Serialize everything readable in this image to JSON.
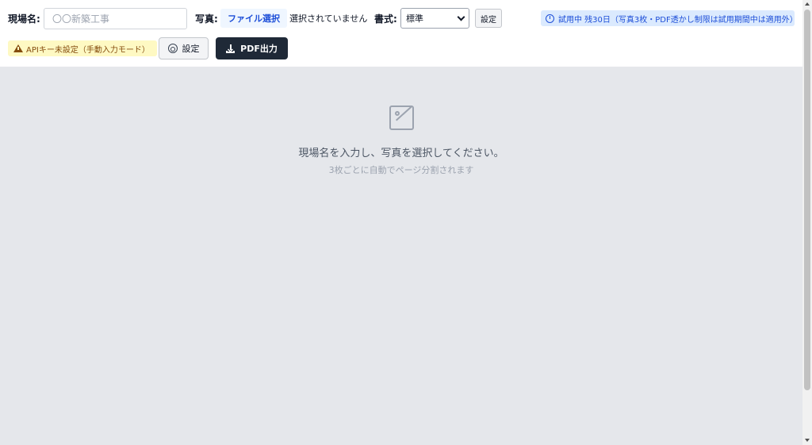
{
  "toolbar": {
    "site_label": "現場名:",
    "site_placeholder": "〇〇新築工事",
    "site_value": "",
    "photo_label": "写真:",
    "file_button": "ファイル選択",
    "file_status": "選択されていません",
    "format_label": "書式:",
    "format_selected": "標準",
    "settings_small": "設定",
    "trial_badge": "試用中 残30日（写真3枚・PDF透かし制限は試用期間中は適用外）",
    "api_badge": "APIキー未設定（手動入力モード）",
    "settings_button": "設定",
    "pdf_button": "PDF出力"
  },
  "canvas": {
    "empty_main": "現場名を入力し、写真を選択してください。",
    "empty_sub": "3枚ごとに自動でページ分割されます"
  },
  "icons": {
    "clock": "clock-icon",
    "warning": "warning-icon",
    "gear": "gear-icon",
    "download": "download-icon",
    "image": "image-placeholder-icon"
  },
  "colors": {
    "dark_button": "#1f2937",
    "trial_bg": "#dbeafe",
    "trial_text": "#1d4ed8",
    "api_bg": "#fef9c3",
    "api_text": "#854d0e",
    "canvas_bg": "#e5e7eb"
  }
}
